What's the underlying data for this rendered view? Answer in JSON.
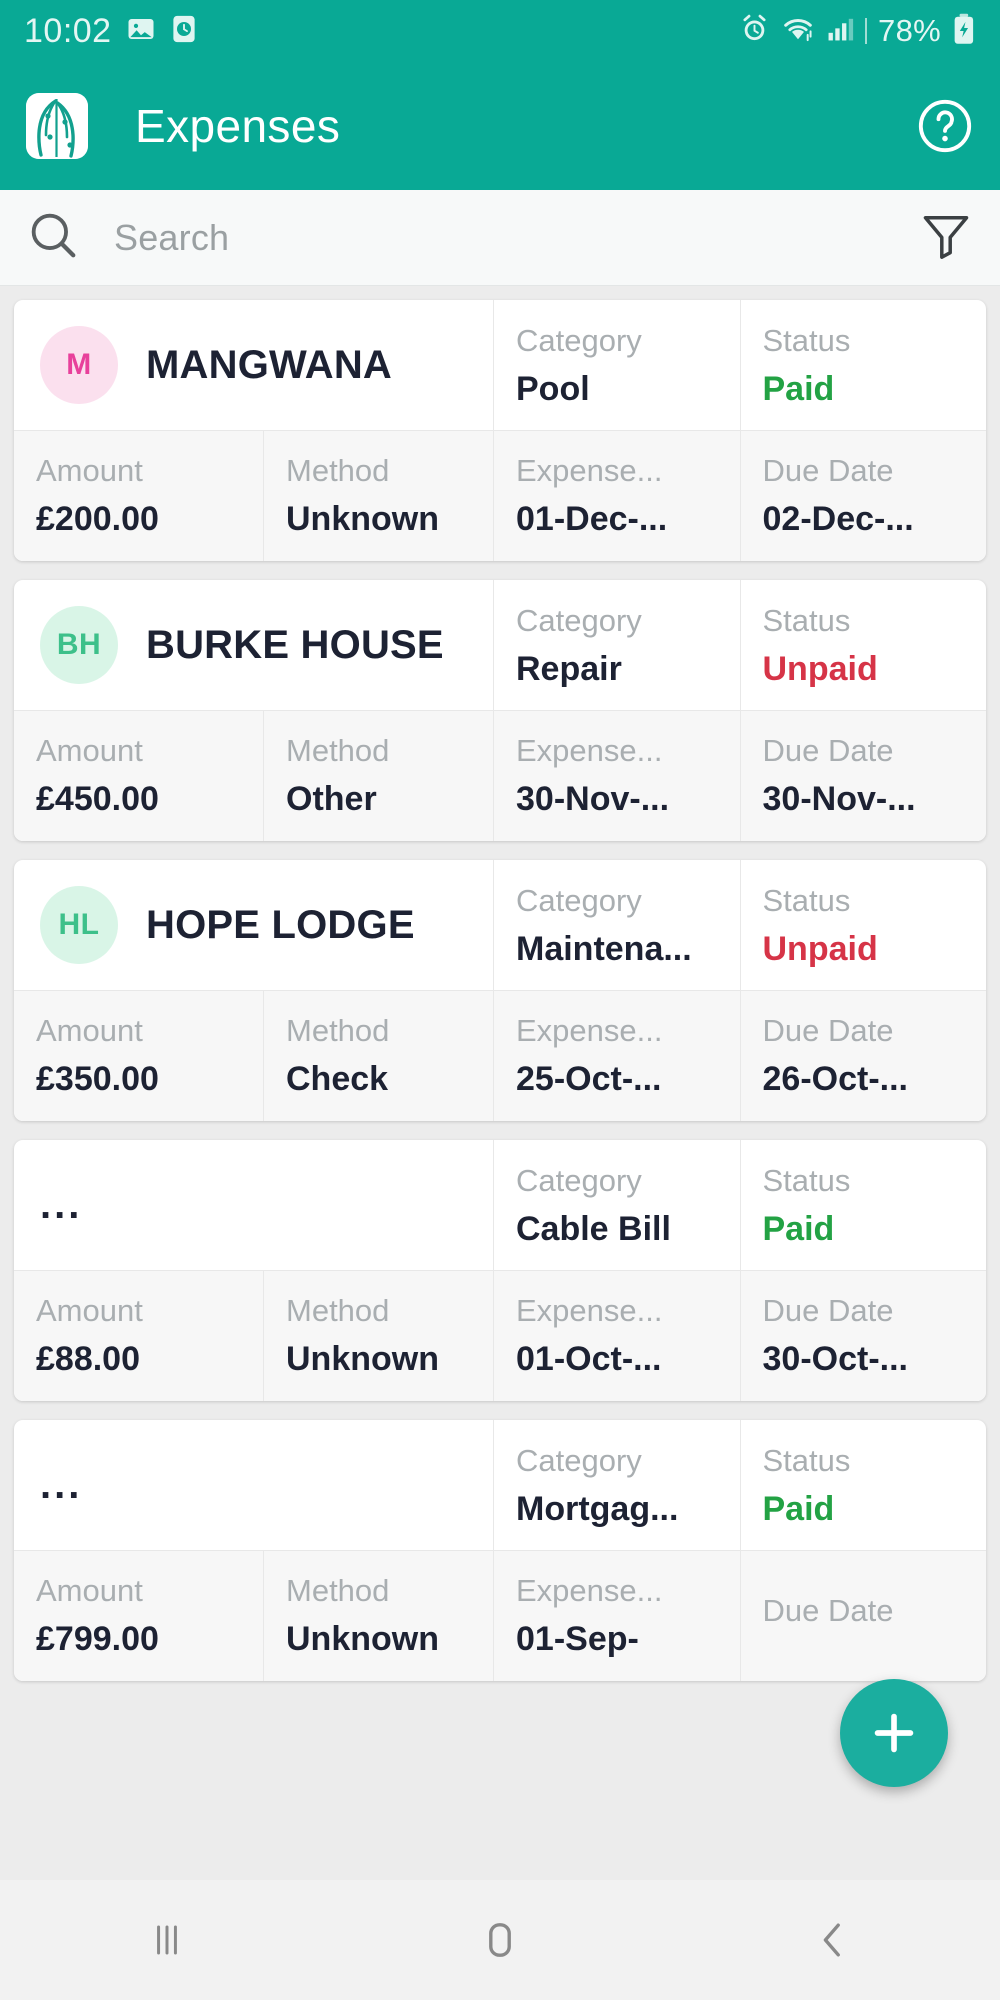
{
  "status_bar": {
    "time": "10:02",
    "battery_percent": "78%",
    "icons": [
      "gallery-icon",
      "clock-icon",
      "alarm-icon",
      "wifi-icon",
      "signal-icon",
      "battery-charging-icon"
    ]
  },
  "app_bar": {
    "title": "Expenses",
    "logo_icon": "app-logo-leaf-icon",
    "help_icon": "help-circle-icon",
    "background_color": "#09A995"
  },
  "search": {
    "placeholder": "Search",
    "search_icon": "search-icon",
    "filter_icon": "filter-funnel-icon"
  },
  "labels": {
    "category": "Category",
    "status": "Status",
    "amount": "Amount",
    "method": "Method",
    "expense_date": "Expense...",
    "due_date": "Due Date"
  },
  "colors": {
    "accent": "#09A995",
    "fab": "#1BAE9F",
    "paid": "#23A244",
    "unpaid": "#D63447",
    "label_grey": "#A9AEB1",
    "value_dark": "#1D2233"
  },
  "expenses": [
    {
      "initials": "M",
      "name": "MANGWANA",
      "avatar_bg": "#FBE0EE",
      "avatar_fg": "#E8409B",
      "category": "Pool",
      "status": "Paid",
      "status_kind": "paid",
      "amount": "£200.00",
      "method": "Unknown",
      "expense_date": "01-Dec-...",
      "due_date": "02-Dec-..."
    },
    {
      "initials": "BH",
      "name": "BURKE HOUSE",
      "avatar_bg": "#D9F5E7",
      "avatar_fg": "#3DC08A",
      "category": "Repair",
      "status": "Unpaid",
      "status_kind": "unpaid",
      "amount": "£450.00",
      "method": "Other",
      "expense_date": "30-Nov-...",
      "due_date": "30-Nov-..."
    },
    {
      "initials": "HL",
      "name": "HOPE LODGE",
      "avatar_bg": "#D9F5E7",
      "avatar_fg": "#3DC08A",
      "category": "Maintena...",
      "status": "Unpaid",
      "status_kind": "unpaid",
      "amount": "£350.00",
      "method": "Check",
      "expense_date": "25-Oct-...",
      "due_date": "26-Oct-..."
    },
    {
      "initials": "",
      "name": "...",
      "avatar_bg": "",
      "avatar_fg": "",
      "category": "Cable Bill",
      "status": "Paid",
      "status_kind": "paid",
      "amount": "£88.00",
      "method": "Unknown",
      "expense_date": "01-Oct-...",
      "due_date": "30-Oct-..."
    },
    {
      "initials": "",
      "name": "...",
      "avatar_bg": "",
      "avatar_fg": "",
      "category": "Mortgag...",
      "status": "Paid",
      "status_kind": "paid",
      "amount": "£799.00",
      "method": "Unknown",
      "expense_date": "01-Sep-",
      "due_date": ""
    }
  ],
  "fab": {
    "icon": "plus-icon",
    "label": "+"
  },
  "nav_bar": {
    "items": [
      {
        "icon": "recents-icon",
        "name": "recents"
      },
      {
        "icon": "home-icon",
        "name": "home"
      },
      {
        "icon": "back-icon",
        "name": "back"
      }
    ]
  }
}
